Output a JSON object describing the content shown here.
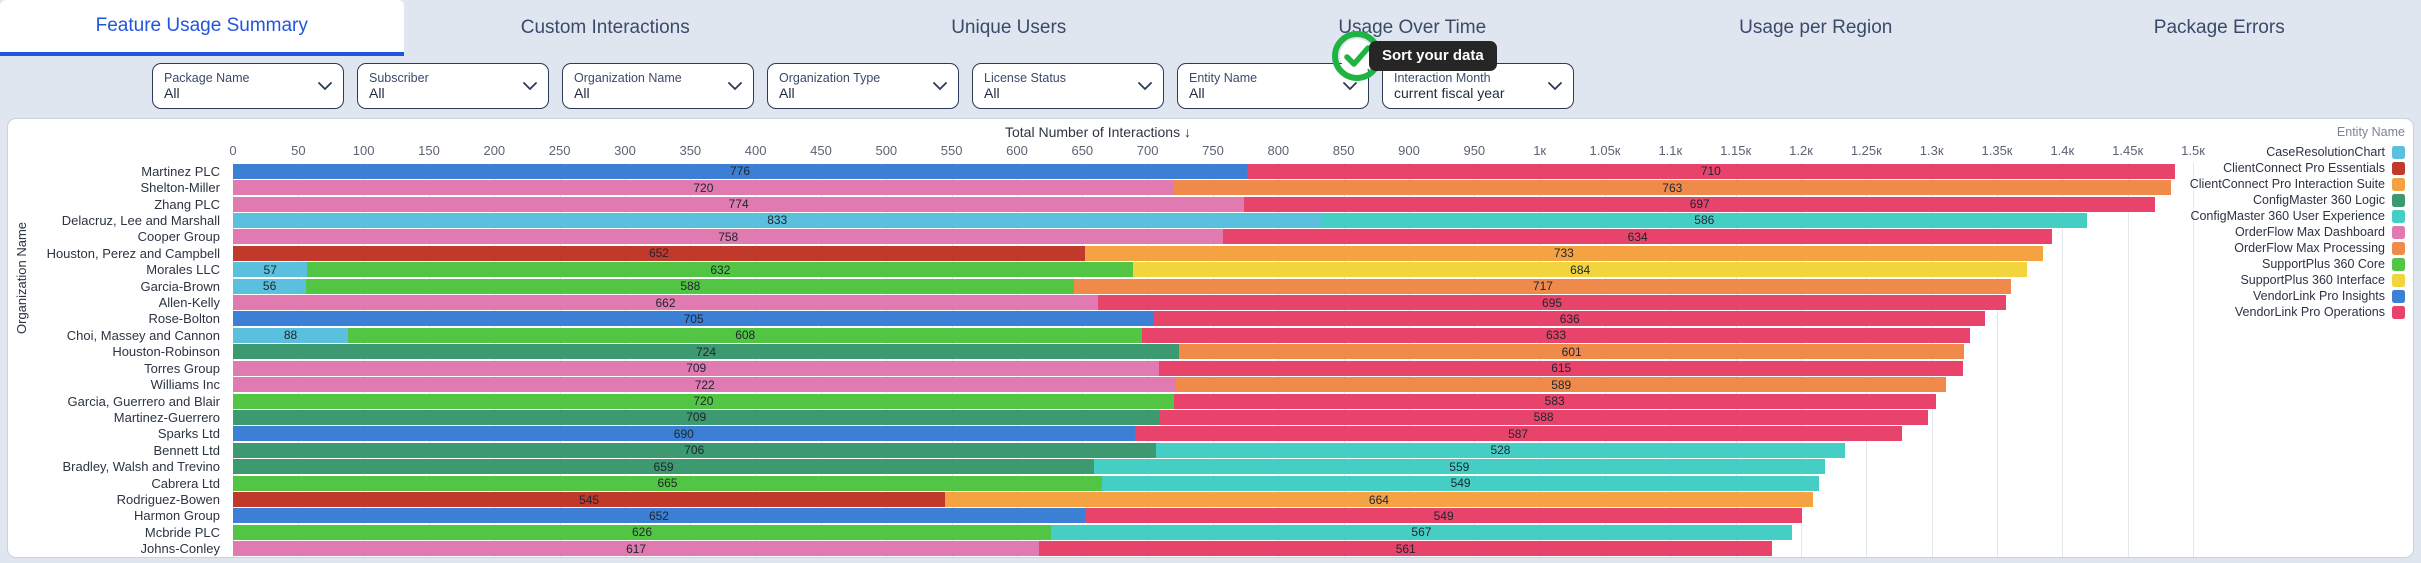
{
  "tabs": [
    {
      "label": "Feature Usage Summary",
      "active": true
    },
    {
      "label": "Custom Interactions",
      "active": false
    },
    {
      "label": "Unique Users",
      "active": false
    },
    {
      "label": "Usage Over Time",
      "active": false
    },
    {
      "label": "Usage per Region",
      "active": false
    },
    {
      "label": "Package Errors",
      "active": false
    }
  ],
  "filters": [
    {
      "label": "Package Name",
      "value": "All"
    },
    {
      "label": "Subscriber",
      "value": "All"
    },
    {
      "label": "Organization Name",
      "value": "All"
    },
    {
      "label": "Organization Type",
      "value": "All"
    },
    {
      "label": "License Status",
      "value": "All"
    },
    {
      "label": "Entity Name",
      "value": "All"
    },
    {
      "label": "Interaction Month",
      "value": "current fiscal year"
    }
  ],
  "tooltip": {
    "text": "Sort your data"
  },
  "cursor": {
    "icon": "green-check-circle-cursor"
  },
  "chart_data": {
    "type": "bar",
    "orientation": "horizontal",
    "stacked": true,
    "title": "",
    "xlabel": "Total Number of Interactions ↓",
    "ylabel": "Organization Name",
    "legend_title": "Entity Name",
    "xlim": [
      0,
      1500
    ],
    "grid": true,
    "legend_position": "right",
    "tick_labels": [
      "0",
      "50",
      "100",
      "150",
      "200",
      "250",
      "300",
      "350",
      "400",
      "450",
      "500",
      "550",
      "600",
      "650",
      "700",
      "750",
      "800",
      "850",
      "900",
      "950",
      "1к",
      "1.05к",
      "1.1к",
      "1.15к",
      "1.2к",
      "1.25к",
      "1.3к",
      "1.35к",
      "1.4к",
      "1.45к",
      "1.5к"
    ],
    "tick_values": [
      0,
      50,
      100,
      150,
      200,
      250,
      300,
      350,
      400,
      450,
      500,
      550,
      600,
      650,
      700,
      750,
      800,
      850,
      900,
      950,
      1000,
      1050,
      1100,
      1150,
      1200,
      1250,
      1300,
      1350,
      1400,
      1450,
      1500
    ],
    "series": [
      {
        "name": "CaseResolutionChart",
        "color": "#5bc0de"
      },
      {
        "name": "ClientConnect Pro Essentials",
        "color": "#c0392b"
      },
      {
        "name": "ClientConnect Pro Interaction Suite",
        "color": "#f5a243"
      },
      {
        "name": "ConfigMaster 360 Logic",
        "color": "#3d9970"
      },
      {
        "name": "ConfigMaster 360 User Experience",
        "color": "#45cfc4"
      },
      {
        "name": "OrderFlow Max Dashboard",
        "color": "#e islands"
      },
      {
        "name": "OrderFlow Max Processing",
        "color": "#f08a4b"
      },
      {
        "name": "SupportPlus 360 Core",
        "color": "#53c544"
      },
      {
        "name": "SupportPlus 360 Interface",
        "color": "#f2d43c"
      },
      {
        "name": "VendorLink Pro Insights",
        "color": "#3b80d4"
      },
      {
        "name": "VendorLink Pro Operations",
        "color": "#e8436b"
      }
    ],
    "legend_colors": {
      "CaseResolutionChart": "#5bc0de",
      "ClientConnect Pro Essentials": "#c0392b",
      "ClientConnect Pro Interaction Suite": "#f5a243",
      "ConfigMaster 360 Logic": "#3d9970",
      "ConfigMaster 360 User Experience": "#45cfc4",
      "OrderFlow Max Dashboard": "#e07ab0",
      "OrderFlow Max Processing": "#f08a4b",
      "SupportPlus 360 Core": "#53c544",
      "SupportPlus 360 Interface": "#f2d43c",
      "VendorLink Pro Insights": "#3b80d4",
      "VendorLink Pro Operations": "#e8436b"
    },
    "categories": [
      "Martinez PLC",
      "Shelton-Miller",
      "Zhang PLC",
      "Delacruz, Lee and Marshall",
      "Cooper Group",
      "Houston, Perez and Campbell",
      "Morales LLC",
      "Garcia-Brown",
      "Allen-Kelly",
      "Rose-Bolton",
      "Choi, Massey and Cannon",
      "Houston-Robinson",
      "Torres Group",
      "Williams Inc",
      "Garcia, Guerrero and Blair",
      "Martinez-Guerrero",
      "Sparks Ltd",
      "Bennett Ltd",
      "Bradley, Walsh and Trevino",
      "Cabrera Ltd",
      "Rodriguez-Bowen",
      "Harmon Group",
      "Mcbride PLC",
      "Johns-Conley"
    ],
    "rows": [
      {
        "category": "Martinez PLC",
        "total": 1500,
        "segments": [
          {
            "color": "#3b80d4",
            "value": 776,
            "label": "776"
          },
          {
            "color": "#e8436b",
            "value": 710,
            "label": "710"
          }
        ]
      },
      {
        "category": "Shelton-Miller",
        "total": 1483,
        "segments": [
          {
            "color": "#e07ab0",
            "value": 720,
            "label": "720"
          },
          {
            "color": "#f08a4b",
            "value": 763,
            "label": "763"
          }
        ]
      },
      {
        "category": "Zhang PLC",
        "total": 1471,
        "segments": [
          {
            "color": "#e07ab0",
            "value": 774,
            "label": "774"
          },
          {
            "color": "#e8436b",
            "value": 697,
            "label": "697"
          }
        ]
      },
      {
        "category": "Delacruz, Lee and Marshall",
        "total": 1419,
        "segments": [
          {
            "color": "#5bc0de",
            "value": 833,
            "label": "833"
          },
          {
            "color": "#45cfc4",
            "value": 586,
            "label": "586"
          }
        ]
      },
      {
        "category": "Cooper Group",
        "total": 1392,
        "segments": [
          {
            "color": "#e07ab0",
            "value": 758,
            "label": "758"
          },
          {
            "color": "#e8436b",
            "value": 634,
            "label": "634"
          }
        ]
      },
      {
        "category": "Houston, Perez and Campbell",
        "total": 1385,
        "segments": [
          {
            "color": "#c0392b",
            "value": 652,
            "label": "652"
          },
          {
            "color": "#f5a243",
            "value": 733,
            "label": "733"
          }
        ]
      },
      {
        "category": "Morales LLC",
        "total": 1373,
        "segments": [
          {
            "color": "#5bc0de",
            "value": 57,
            "label": "57"
          },
          {
            "color": "#53c544",
            "value": 632,
            "label": "632"
          },
          {
            "color": "#f2d43c",
            "value": 684,
            "label": "684"
          }
        ]
      },
      {
        "category": "Garcia-Brown",
        "total": 1361,
        "segments": [
          {
            "color": "#5bc0de",
            "value": 56,
            "label": "56"
          },
          {
            "color": "#53c544",
            "value": 588,
            "label": "588"
          },
          {
            "color": "#f08a4b",
            "value": 717,
            "label": "717"
          }
        ]
      },
      {
        "category": "Allen-Kelly",
        "total": 1357,
        "segments": [
          {
            "color": "#e07ab0",
            "value": 662,
            "label": "662"
          },
          {
            "color": "#e8436b",
            "value": 695,
            "label": "695"
          }
        ]
      },
      {
        "category": "Rose-Bolton",
        "total": 1341,
        "segments": [
          {
            "color": "#3b80d4",
            "value": 705,
            "label": "705"
          },
          {
            "color": "#e8436b",
            "value": 636,
            "label": "636"
          }
        ]
      },
      {
        "category": "Choi, Massey and Cannon",
        "total": 1329,
        "segments": [
          {
            "color": "#5bc0de",
            "value": 88,
            "label": "88"
          },
          {
            "color": "#53c544",
            "value": 608,
            "label": "608"
          },
          {
            "color": "#e8436b",
            "value": 633,
            "label": "633"
          }
        ]
      },
      {
        "category": "Houston-Robinson",
        "total": 1325,
        "segments": [
          {
            "color": "#3d9970",
            "value": 724,
            "label": "724"
          },
          {
            "color": "#f08a4b",
            "value": 601,
            "label": "601"
          }
        ]
      },
      {
        "category": "Torres Group",
        "total": 1324,
        "segments": [
          {
            "color": "#e07ab0",
            "value": 709,
            "label": "709"
          },
          {
            "color": "#e8436b",
            "value": 615,
            "label": "615"
          }
        ]
      },
      {
        "category": "Williams Inc",
        "total": 1311,
        "segments": [
          {
            "color": "#e07ab0",
            "value": 722,
            "label": "722"
          },
          {
            "color": "#f08a4b",
            "value": 589,
            "label": "589"
          }
        ]
      },
      {
        "category": "Garcia, Guerrero and Blair",
        "total": 1303,
        "segments": [
          {
            "color": "#53c544",
            "value": 720,
            "label": "720"
          },
          {
            "color": "#e8436b",
            "value": 583,
            "label": "583"
          }
        ]
      },
      {
        "category": "Martinez-Guerrero",
        "total": 1297,
        "segments": [
          {
            "color": "#3d9970",
            "value": 709,
            "label": "709"
          },
          {
            "color": "#e8436b",
            "value": 588,
            "label": "588"
          }
        ]
      },
      {
        "category": "Sparks Ltd",
        "total": 1277,
        "segments": [
          {
            "color": "#3b80d4",
            "value": 690,
            "label": "690"
          },
          {
            "color": "#e8436b",
            "value": 587,
            "label": "587"
          }
        ]
      },
      {
        "category": "Bennett Ltd",
        "total": 1234,
        "segments": [
          {
            "color": "#3d9970",
            "value": 706,
            "label": "706"
          },
          {
            "color": "#45cfc4",
            "value": 528,
            "label": "528"
          }
        ]
      },
      {
        "category": "Bradley, Walsh and Trevino",
        "total": 1218,
        "segments": [
          {
            "color": "#3d9970",
            "value": 659,
            "label": "659"
          },
          {
            "color": "#45cfc4",
            "value": 559,
            "label": "559"
          }
        ]
      },
      {
        "category": "Cabrera Ltd",
        "total": 1214,
        "segments": [
          {
            "color": "#53c544",
            "value": 665,
            "label": "665"
          },
          {
            "color": "#45cfc4",
            "value": 549,
            "label": "549"
          }
        ]
      },
      {
        "category": "Rodriguez-Bowen",
        "total": 1209,
        "segments": [
          {
            "color": "#c0392b",
            "value": 545,
            "label": "545"
          },
          {
            "color": "#f5a243",
            "value": 664,
            "label": "664"
          }
        ]
      },
      {
        "category": "Harmon Group",
        "total": 1201,
        "segments": [
          {
            "color": "#3b80d4",
            "value": 652,
            "label": "652"
          },
          {
            "color": "#e8436b",
            "value": 549,
            "label": "549"
          }
        ]
      },
      {
        "category": "Mcbride PLC",
        "total": 1193,
        "segments": [
          {
            "color": "#53c544",
            "value": 626,
            "label": "626"
          },
          {
            "color": "#45cfc4",
            "value": 567,
            "label": "567"
          }
        ]
      },
      {
        "category": "Johns-Conley",
        "total": 1178,
        "segments": [
          {
            "color": "#e07ab0",
            "value": 617,
            "label": "617"
          },
          {
            "color": "#e8436b",
            "value": 561,
            "label": "561"
          }
        ]
      }
    ]
  }
}
